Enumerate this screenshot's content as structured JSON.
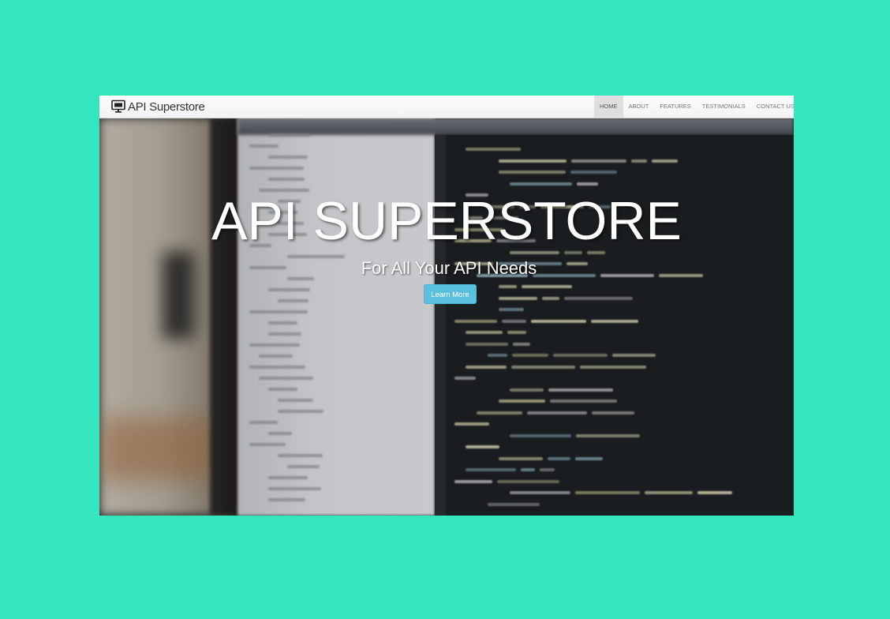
{
  "navbar": {
    "brand": "API Superstore",
    "brand_icon": "monitor-icon",
    "items": [
      {
        "label": "HOME",
        "active": true
      },
      {
        "label": "ABOUT",
        "active": false
      },
      {
        "label": "FEATURES",
        "active": false
      },
      {
        "label": "TESTIMONIALS",
        "active": false
      },
      {
        "label": "CONTACT US",
        "active": false
      }
    ]
  },
  "hero": {
    "title": "API SUPERSTORE",
    "subtitle": "For All Your API Needs",
    "button_label": "Learn More",
    "button_color": "#5bc0de"
  },
  "colors": {
    "page_background": "#33e6bd",
    "navbar_background": "#ffffff",
    "active_nav_background": "#dfdfdf"
  }
}
